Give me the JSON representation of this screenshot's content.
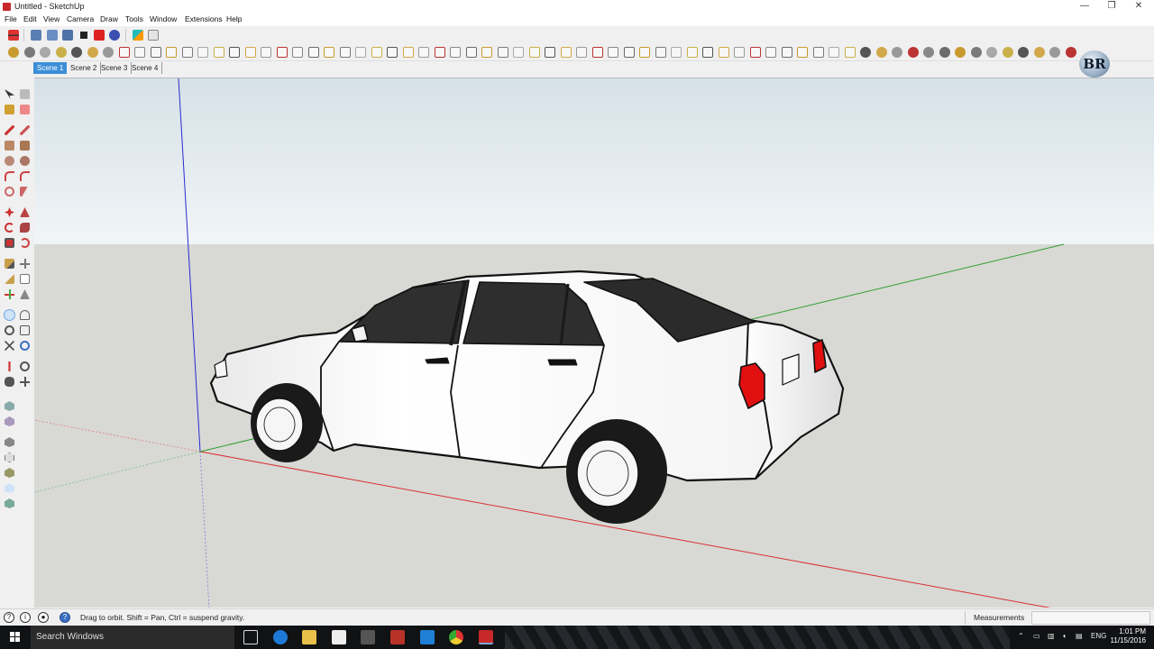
{
  "window": {
    "title": "Untitled - SketchUp",
    "controls": {
      "minimize": "—",
      "maximize": "❐",
      "close": "✕"
    }
  },
  "menubar": [
    "File",
    "Edit",
    "View",
    "Camera",
    "Draw",
    "Tools",
    "Window",
    "Extensions",
    "Help"
  ],
  "scenes": {
    "tabs": [
      "Scene 1",
      "Scene 2",
      "Scene 3",
      "Scene 4"
    ],
    "active": "Scene 1"
  },
  "watermark": {
    "text": "BR"
  },
  "model": {
    "description_icon": "car-model",
    "body_color": "#ffffff",
    "glass_color": "#2f2f2f",
    "taillight_color": "#e01010",
    "tire_color": "#1a1a1a"
  },
  "viewport": {
    "sky_color": "#e6eef2",
    "ground_color": "#d8d8d5",
    "axis_colors": {
      "red": "#d83030",
      "green": "#2fa02f",
      "blue": "#2a2ad0"
    }
  },
  "statusbar": {
    "hint": "Drag to orbit. Shift = Pan, Ctrl = suspend gravity.",
    "measurements_label": "Measurements",
    "measurements_value": ""
  },
  "taskbar": {
    "search_placeholder": "Search Windows",
    "language": "ENG",
    "time": "1:01 PM",
    "date": "11/15/2016",
    "pinned": [
      "task-view-icon",
      "edge-icon",
      "file-explorer-icon",
      "store-icon",
      "media-icon",
      "app-icon",
      "window-icon",
      "chrome-icon",
      "sketchup-icon"
    ]
  }
}
